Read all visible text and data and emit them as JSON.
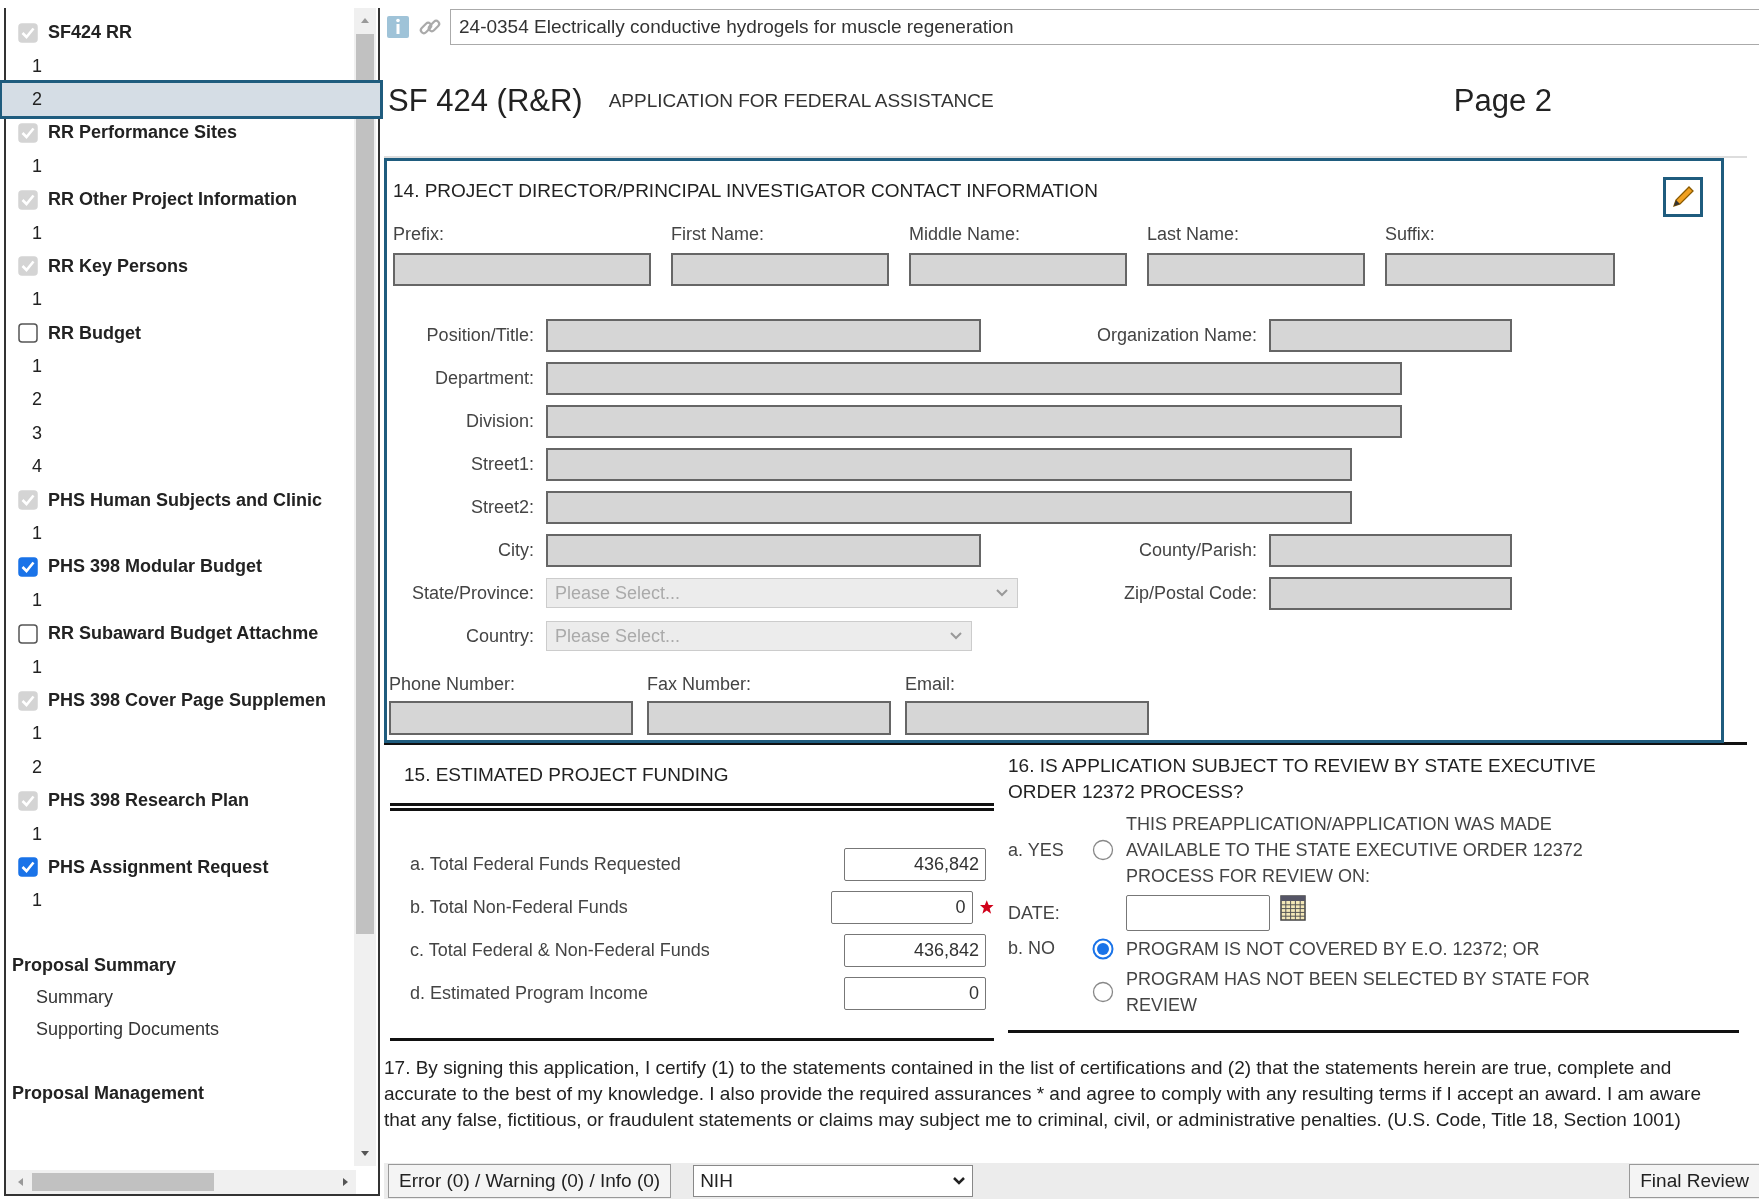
{
  "sidebar": {
    "forms": [
      {
        "label": "SF424 RR",
        "checked": true,
        "disabled": true,
        "pages": [
          {
            "label": "1",
            "selected": false
          },
          {
            "label": "2",
            "selected": true
          }
        ]
      },
      {
        "label": "RR Performance Sites",
        "checked": true,
        "disabled": true,
        "pages": [
          {
            "label": "1",
            "selected": false
          }
        ]
      },
      {
        "label": "RR Other Project Information",
        "checked": true,
        "disabled": true,
        "pages": [
          {
            "label": "1",
            "selected": false
          }
        ]
      },
      {
        "label": "RR Key Persons",
        "checked": true,
        "disabled": true,
        "pages": [
          {
            "label": "1",
            "selected": false
          }
        ]
      },
      {
        "label": "RR Budget",
        "checked": false,
        "disabled": false,
        "pages": [
          {
            "label": "1",
            "selected": false
          },
          {
            "label": "2",
            "selected": false
          },
          {
            "label": "3",
            "selected": false
          },
          {
            "label": "4",
            "selected": false
          }
        ]
      },
      {
        "label": "PHS Human Subjects and Clinic",
        "checked": true,
        "disabled": true,
        "pages": [
          {
            "label": "1",
            "selected": false
          }
        ]
      },
      {
        "label": "PHS 398 Modular Budget",
        "checked": true,
        "disabled": false,
        "pages": [
          {
            "label": "1",
            "selected": false
          }
        ]
      },
      {
        "label": "RR Subaward Budget Attachme",
        "checked": false,
        "disabled": false,
        "pages": [
          {
            "label": "1",
            "selected": false
          }
        ]
      },
      {
        "label": "PHS 398 Cover Page Supplemen",
        "checked": true,
        "disabled": true,
        "pages": [
          {
            "label": "1",
            "selected": false
          },
          {
            "label": "2",
            "selected": false
          }
        ]
      },
      {
        "label": "PHS 398 Research Plan",
        "checked": true,
        "disabled": true,
        "pages": [
          {
            "label": "1",
            "selected": false
          }
        ]
      },
      {
        "label": "PHS Assignment Request",
        "checked": true,
        "disabled": false,
        "pages": [
          {
            "label": "1",
            "selected": false
          }
        ]
      }
    ],
    "sections": [
      {
        "title": "Proposal Summary",
        "items": [
          "Summary",
          "Supporting Documents"
        ]
      },
      {
        "title": "Proposal Management"
      }
    ]
  },
  "toolbar": {
    "title": "24-0354 Electrically conductive hydrogels for muscle regeneration"
  },
  "header": {
    "form_name": "SF 424 (R&R)",
    "subtitle": "APPLICATION FOR FEDERAL ASSISTANCE",
    "page": "Page 2"
  },
  "contact_section": {
    "title": "14. PROJECT DIRECTOR/PRINCIPAL INVESTIGATOR CONTACT INFORMATION",
    "name_fields": [
      {
        "label": "Prefix:"
      },
      {
        "label": "First Name:"
      },
      {
        "label": "Middle Name:"
      },
      {
        "label": "Last Name:"
      },
      {
        "label": "Suffix:"
      }
    ],
    "rows": [
      [
        {
          "label": "Position/Title:",
          "kind": "text"
        },
        {
          "label": "Organization Name:",
          "kind": "text"
        }
      ],
      [
        {
          "label": "Department:",
          "kind": "text"
        }
      ],
      [
        {
          "label": "Division:",
          "kind": "text"
        }
      ],
      [
        {
          "label": "Street1:",
          "kind": "text"
        }
      ],
      [
        {
          "label": "Street2:",
          "kind": "text"
        }
      ],
      [
        {
          "label": "City:",
          "kind": "text"
        },
        {
          "label": "County/Parish:",
          "kind": "text"
        }
      ],
      [
        {
          "label": "State/Province:",
          "kind": "select",
          "placeholder": "Please Select..."
        },
        {
          "label": "Zip/Postal Code:",
          "kind": "text"
        }
      ],
      [
        {
          "label": "Country:",
          "kind": "select",
          "placeholder": "Please Select..."
        }
      ]
    ],
    "contact_fields": [
      {
        "label": "Phone Number:"
      },
      {
        "label": "Fax Number:"
      },
      {
        "label": "Email:"
      }
    ]
  },
  "funding_section": {
    "title": "15. ESTIMATED PROJECT FUNDING",
    "rows": [
      {
        "label": "a. Total Federal Funds Requested",
        "value": "436,842",
        "required": false
      },
      {
        "label": "b. Total Non-Federal Funds",
        "value": "0",
        "required": true
      },
      {
        "label": "c. Total Federal & Non-Federal Funds",
        "value": "436,842",
        "required": false
      },
      {
        "label": "d. Estimated Program Income",
        "value": "0",
        "required": false
      }
    ]
  },
  "review_section": {
    "title": "16. IS APPLICATION SUBJECT TO REVIEW BY STATE EXECUTIVE ORDER 12372 PROCESS?",
    "options": [
      {
        "label": "a. YES",
        "text": "THIS PREAPPLICATION/APPLICATION WAS MADE AVAILABLE TO THE STATE EXECUTIVE ORDER 12372 PROCESS FOR REVIEW ON:",
        "selected": false
      },
      {
        "label": "b. NO",
        "text": "PROGRAM IS NOT COVERED BY E.O. 12372; OR",
        "selected": true
      },
      {
        "text": "PROGRAM HAS NOT BEEN SELECTED BY STATE FOR REVIEW",
        "selected": false
      }
    ],
    "date": {
      "label": "DATE:"
    }
  },
  "certification": "17. By signing this application, I certify (1) to the statements contained in the list of certifications and (2) that the statements herein are true, complete and accurate to the best of my knowledge. I also provide the required assurances * and agree to comply with any resulting terms if I accept an award. I am aware that any false, fictitious, or fraudulent statements or claims may subject me to criminal, civil, or administrative penalties. (U.S. Code, Title 18, Section 1001)",
  "status_bar": {
    "messages": "Error (0) / Warning (0) / Info (0)",
    "agency": "NIH",
    "final_review": "Final Review"
  }
}
